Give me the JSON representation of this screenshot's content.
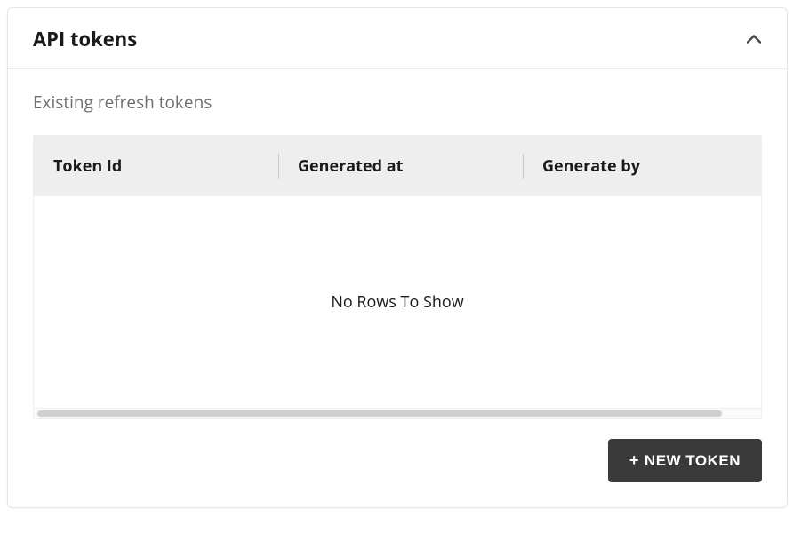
{
  "header": {
    "title": "API tokens"
  },
  "subtitle": "Existing refresh tokens",
  "table": {
    "columns": {
      "c0": "Token Id",
      "c1": "Generated at",
      "c2": "Generate by"
    },
    "empty_message": "No Rows To Show"
  },
  "actions": {
    "new_token_label": "NEW TOKEN",
    "plus_glyph": "+"
  }
}
